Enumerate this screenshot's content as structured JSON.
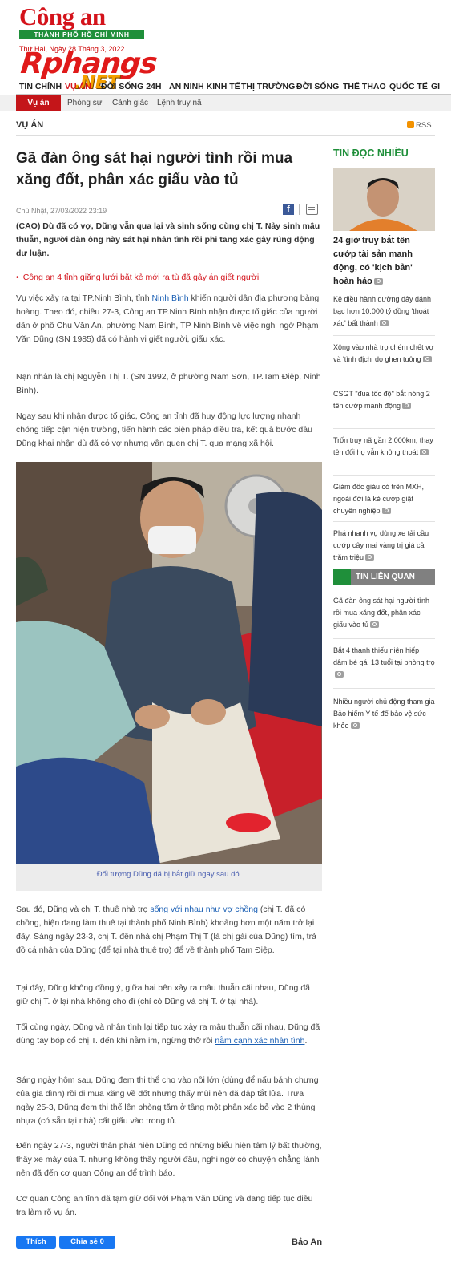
{
  "header": {
    "logo_main": "Công an",
    "logo_sub": "THÀNH PHỐ HỒ CHÍ MINH",
    "date": "Thứ Hai, Ngày 28 Tháng 3, 2022",
    "watermark_top": "Rphangs",
    "watermark_bottom": ".NET"
  },
  "nav": {
    "items": [
      "TIN CHÍNH",
      "VỤ ÁN",
      "ĐỜI SỐNG 24H",
      "AN NINH KINH TẾ",
      "THỊ TRƯỜNG",
      "ĐỜI SỐNG",
      "THỂ THAO",
      "QUỐC TẾ",
      "GI"
    ],
    "active_index": 1
  },
  "subnav": {
    "items": [
      "Vụ án",
      "Phóng sự",
      "Cảnh giác",
      "Lệnh truy nã"
    ]
  },
  "section": {
    "title": "VỤ ÁN",
    "rss": "RSS"
  },
  "article": {
    "title": "Gã đàn ông sát hại người tình rồi mua xăng đốt, phân xác giấu vào tủ",
    "meta": "Chủ Nhật, 27/03/2022 23:19",
    "sapo": "(CAO) Dù đã có vợ, Dũng vẫn qua lại và sinh sống cùng chị T. Nảy sinh mâu thuẫn, người đàn ông này sát hại nhân tình rồi phi tang xác gây rúng động dư luận.",
    "related_inline": "Công an 4 tỉnh giăng lưới bắt kẻ mới ra tù đã gây án giết người",
    "p1_a": "Vụ việc xảy ra tại TP.Ninh Bình, tỉnh",
    "p1_link": " Ninh Bình",
    "p1_b": " khiến người dân địa phương bàng hoàng. Theo đó, chiều 27-3, Công an TP.Ninh Bình nhận được tố giác của người dân ở phố Chu Văn An, phường Nam Bình, TP Ninh Bình về việc nghi ngờ Phạm Văn Dũng (SN 1985) đã có hành vi giết người, giấu xác.",
    "p2": "Nạn nhân là chị Nguyễn Thị T. (SN 1992, ở phường Nam Sơn, TP.Tam Điệp, Ninh Bình).",
    "p3": "Ngay sau khi nhận được tố giác, Công an tỉnh đã huy động lực lượng nhanh chóng tiếp cận hiện trường, tiến hành các biện pháp điều tra, kết quả bước đầu Dũng khai nhận dù đã có vợ nhưng vẫn quen chị T. qua mạng xã hội.",
    "caption": "Đối tượng Dũng đã bị bắt giữ ngay sau đó.",
    "p4_a": "Sau đó, Dũng và chị T. thuê nhà trọ ",
    "p4_link": "sống với nhau như vợ chồng",
    "p4_b": " (chị T. đã có chồng, hiện đang làm thuê tại thành phố Ninh Bình) khoảng hơn một năm trở lại đây. Sáng ngày 23-3, chị T. đến nhà chị Phạm Thị T (là chị gái của Dũng) tìm, trả đồ cá nhân của Dũng (để tại nhà thuê trọ) để về thành phố Tam Điệp.",
    "p5": "Tại đây, Dũng không đồng ý, giữa hai bên xảy ra mâu thuẫn cãi nhau, Dũng đã giữ chị T. ở lại nhà không cho đi (chỉ có Dũng và chị T. ở tại nhà).",
    "p6_a": "Tối cùng ngày, Dũng và nhân tình lại tiếp tục xảy ra mâu thuẫn cãi nhau, Dũng đã dùng tay bóp cổ chị T. đến khi nằm im, ngừng thở rồi ",
    "p6_link": "nằm cạnh xác nhân tình",
    "p6_b": ".",
    "p7": "Sáng ngày hôm sau, Dũng đem thi thể cho vào nồi lớn (dùng để nấu bánh chưng của gia đình) rồi đi mua xăng về đốt nhưng thấy mùi nên đã dập tắt lửa. Trưa ngày 25-3, Dũng đem thi thể lên phòng tắm ở tầng một phân xác bỏ vào 2 thùng nhựa (có sẵn tại nhà) cất giấu vào trong tủ.",
    "p8": "Đến ngày 27-3, người thân phát hiện Dũng có những biểu hiện tâm lý bất thường, thấy xe máy của T. nhưng không thấy người đâu, nghi ngờ có chuyện chẳng lành nên đã đến cơ quan Công an để trình báo.",
    "p9": "Cơ quan Công an tỉnh đã tạm giữ đối với Phạm Văn Dũng và đang tiếp tục điều tra làm rõ vụ án.",
    "like": "Thích",
    "share": "Chia sẻ 0",
    "author": "Bảo An"
  },
  "sidebar": {
    "most_read_title": "TIN ĐỌC NHIỀU",
    "top_story": "24 giờ truy bắt tên cướp tài sản manh động, có 'kịch bản' hoàn hảo",
    "items": [
      "Kẻ điều hành đường dây đánh bạc hơn 10.000 tỷ đồng 'thoát xác' bất thành",
      "Xông vào nhà trọ chém chết vợ và 'tình địch' do ghen tuông",
      "CSGT \"đua tốc độ\" bắt nóng 2 tên cướp manh động",
      "Trốn truy nã gần 2.000km, thay tên đổi họ vẫn không thoát",
      "Giám đốc giàu có trên MXH, ngoài đời là kẻ cướp giật chuyên nghiệp",
      "Phá nhanh vụ dùng xe tải cầu cướp cây mai vàng trị giá cả trăm triệu"
    ],
    "related_title": "TIN LIÊN QUAN",
    "related": [
      "Gã đàn ông sát hại người tình rồi mua xăng đốt, phân xác giấu vào tủ",
      "Bắt 4 thanh thiếu niên hiếp dâm bé gái 13 tuổi tại phòng trọ",
      "Nhiều người chủ động tham gia Bảo hiểm Y tế để bảo vệ sức khỏe"
    ]
  },
  "colors": {
    "brand_red": "#d4131b",
    "brand_green": "#1f8f3a",
    "link_blue": "#1a5fb4"
  }
}
